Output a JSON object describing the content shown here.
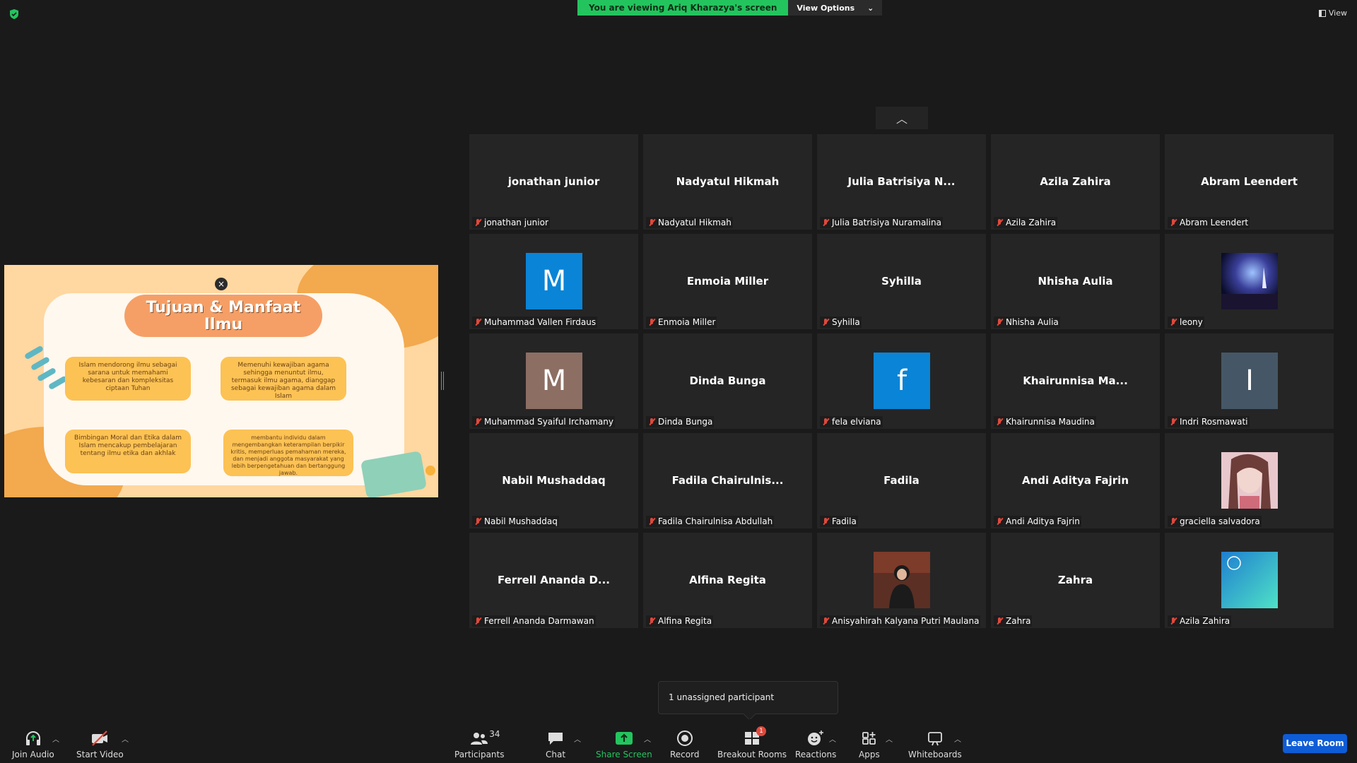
{
  "top": {
    "banner_text": "You are viewing Ariq Kharazya's screen",
    "view_options_label": "View Options",
    "view_label": "View"
  },
  "shared_slide": {
    "title": "Tujuan & Manfaat Ilmu",
    "cards": [
      "Islam mendorong ilmu sebagai sarana untuk memahami kebesaran dan kompleksitas ciptaan Tuhan",
      "Memenuhi kewajiban agama sehingga menuntut ilmu, termasuk ilmu agama, dianggap sebagai kewajiban agama dalam Islam",
      "Bimbingan Moral dan Etika dalam Islam mencakup pembelajaran tentang ilmu etika dan akhlak",
      "membantu individu dalam mengembangkan keterampilan berpikir kritis, memperluas pemahaman mereka, dan menjadi anggota masyarakat yang lebih berpengetahuan dan bertanggung jawab."
    ]
  },
  "participants": [
    {
      "display": "jonathan junior",
      "label": "jonathan junior",
      "kind": "name"
    },
    {
      "display": "Nadyatul Hikmah",
      "label": "Nadyatul Hikmah",
      "kind": "name"
    },
    {
      "display": "Julia  Batrisiya  N...",
      "label": "Julia Batrisiya Nuramalina",
      "kind": "name"
    },
    {
      "display": "Azila Zahira",
      "label": "Azila Zahira",
      "kind": "name"
    },
    {
      "display": "Abram Leendert",
      "label": "Abram Leendert",
      "kind": "name"
    },
    {
      "display": "M",
      "label": "Muhammad Vallen Firdaus",
      "kind": "letter",
      "color": "#0a84d6"
    },
    {
      "display": "Enmoia Miller",
      "label": "Enmoia Miller",
      "kind": "name"
    },
    {
      "display": "Syhilla",
      "label": "Syhilla",
      "kind": "name"
    },
    {
      "display": "Nhisha Aulia",
      "label": "Nhisha Aulia",
      "kind": "name"
    },
    {
      "display": "",
      "label": "leony",
      "kind": "photo",
      "photo": "night-stage"
    },
    {
      "display": "M",
      "label": "Muhammad Syaiful Irchamany",
      "kind": "letter",
      "color": "#8d6e63"
    },
    {
      "display": "Dinda Bunga",
      "label": "Dinda Bunga",
      "kind": "name"
    },
    {
      "display": "f",
      "label": "fela elviana",
      "kind": "letter",
      "color": "#0a84d6"
    },
    {
      "display": "Khairunnisa  Ma...",
      "label": "Khairunnisa Maudina",
      "kind": "name"
    },
    {
      "display": "I",
      "label": "Indri Rosmawati",
      "kind": "letter",
      "color": "#455766"
    },
    {
      "display": "Nabil Mushaddaq",
      "label": "Nabil Mushaddaq",
      "kind": "name"
    },
    {
      "display": "Fadila  Chairulnis...",
      "label": "Fadila Chairulnisa Abdullah",
      "kind": "name"
    },
    {
      "display": "Fadila",
      "label": "Fadila",
      "kind": "name"
    },
    {
      "display": "Andi Aditya Fajrin",
      "label": "Andi Aditya Fajrin",
      "kind": "name"
    },
    {
      "display": "",
      "label": "graciella salvadora",
      "kind": "photo",
      "photo": "portrait-pink"
    },
    {
      "display": "Ferrell  Ananda  D...",
      "label": "Ferrell Ananda Darmawan",
      "kind": "name"
    },
    {
      "display": "Alfina Regita",
      "label": "Alfina Regita",
      "kind": "name"
    },
    {
      "display": "",
      "label": "Anisyahirah Kalyana Putri Maulana",
      "kind": "photo",
      "photo": "portrait-dark"
    },
    {
      "display": "Zahra",
      "label": "Zahra",
      "kind": "name"
    },
    {
      "display": "",
      "label": "Azila Zahira",
      "kind": "photo",
      "photo": "teal-gradient"
    }
  ],
  "popup_text": "1 unassigned participant",
  "toolbar": {
    "join_audio": "Join Audio",
    "start_video": "Start Video",
    "participants": "Participants",
    "participant_count": "34",
    "chat": "Chat",
    "share_screen": "Share Screen",
    "record": "Record",
    "breakout_rooms": "Breakout Rooms",
    "breakout_badge": "1",
    "reactions": "Reactions",
    "apps": "Apps",
    "whiteboards": "Whiteboards",
    "leave_room": "Leave Room"
  }
}
